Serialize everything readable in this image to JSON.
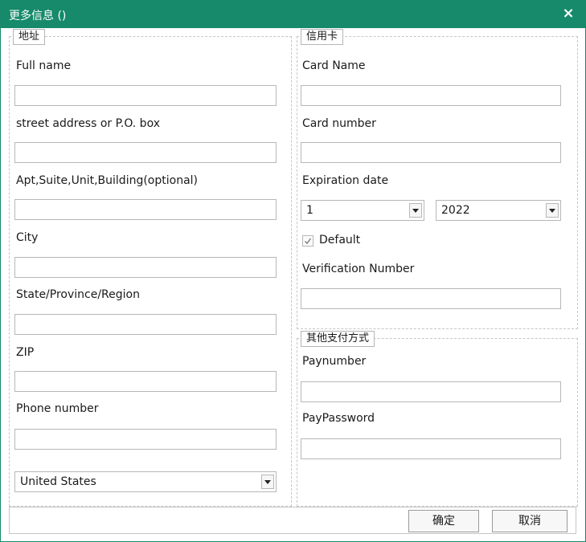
{
  "window": {
    "title": "更多信息 ()",
    "close_glyph": "×"
  },
  "address": {
    "legend": "地址",
    "fields": [
      {
        "label": "Full name",
        "value": ""
      },
      {
        "label": "street address or P.O. box",
        "value": ""
      },
      {
        "label": "Apt,Suite,Unit,Building(optional)",
        "value": ""
      },
      {
        "label": "City",
        "value": ""
      },
      {
        "label": "State/Province/Region",
        "value": ""
      },
      {
        "label": "ZIP",
        "value": ""
      },
      {
        "label": "Phone number",
        "value": ""
      }
    ],
    "country": {
      "selected": "United States"
    }
  },
  "credit_card": {
    "legend": "信用卡",
    "card_name": {
      "label": "Card Name",
      "value": ""
    },
    "card_number": {
      "label": "Card number",
      "value": ""
    },
    "expiration": {
      "label": "Expiration date",
      "month": "1",
      "year": "2022"
    },
    "default": {
      "label": "Default",
      "checked": true
    },
    "verification": {
      "label": "Verification Number",
      "value": ""
    }
  },
  "other_payment": {
    "legend": "其他支付方式",
    "paynumber": {
      "label": "Paynumber",
      "value": ""
    },
    "paypassword": {
      "label": "PayPassword",
      "value": ""
    }
  },
  "footer": {
    "ok_label": "确定",
    "cancel_label": "取消"
  },
  "colors": {
    "titlebar": "#168a6a",
    "border": "#c6c6c6"
  },
  "icons": [
    "close-icon",
    "dropdown-arrow-icon",
    "checkmark-icon"
  ]
}
